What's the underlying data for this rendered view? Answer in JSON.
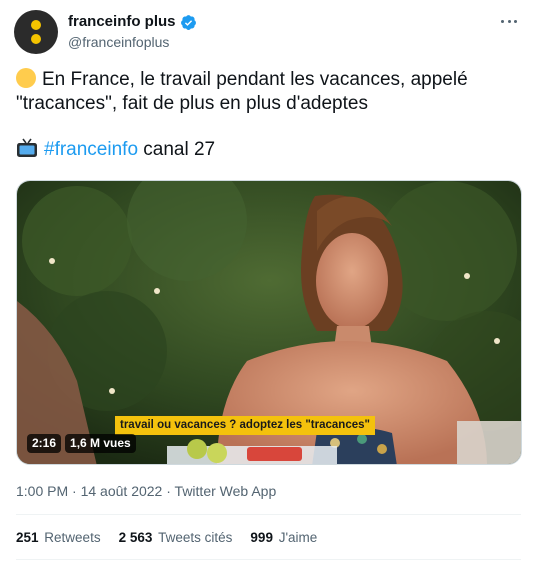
{
  "author": {
    "name": "franceinfo plus",
    "handle": "@franceinfoplus",
    "verified": true
  },
  "icons": {
    "avatar": "franceinfo-logo",
    "verified": "verified-badge-icon",
    "more": "more-options-icon",
    "emoji_1": "yellow-circle-emoji",
    "emoji_2": "television-emoji"
  },
  "tweet": {
    "line1": "En France, le travail pendant les vacances, appelé \"tracances\", fait de plus en plus d'adeptes",
    "hashtag": "#franceinfo",
    "channel": " canal 27"
  },
  "media": {
    "caption": "travail ou vacances ? adoptez les \"tracances\"",
    "duration": "2:16",
    "views": "1,6 M vues"
  },
  "meta": {
    "time": "1:00 PM",
    "separator1": " · ",
    "date": "14 août 2022",
    "separator2": " · ",
    "source": "Twitter Web App"
  },
  "stats": {
    "retweets_count": "251",
    "retweets_label": "Retweets",
    "quotes_count": "2 563",
    "quotes_label": "Tweets cités",
    "likes_count": "999",
    "likes_label": "J'aime"
  },
  "colors": {
    "accent": "#1d9bf0",
    "caption_bg": "#f4c20d",
    "logo_dot": "#f5c400"
  }
}
